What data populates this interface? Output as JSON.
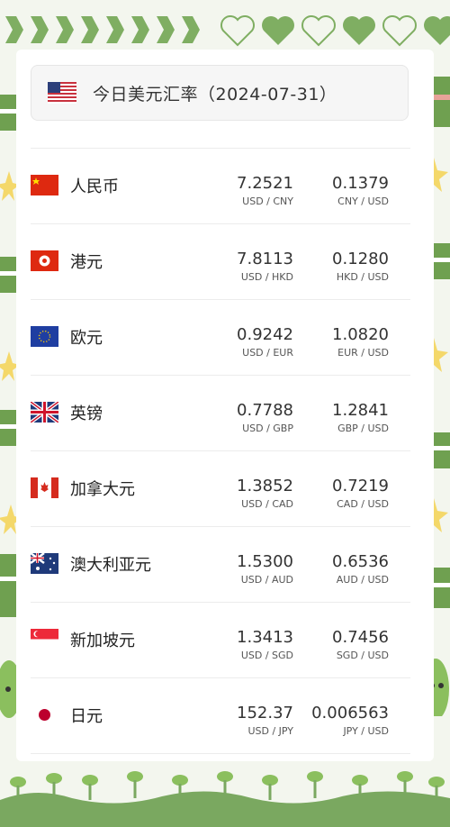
{
  "header": {
    "title": "今日美元汇率（2024-07-31）",
    "flag_icon": "us-flag-icon"
  },
  "rates": [
    {
      "name": "人民币",
      "flag": "cn-flag-icon",
      "rate": "7.2521",
      "rate_unit": "USD / CNY",
      "inverse": "0.1379",
      "inverse_unit": "CNY / USD"
    },
    {
      "name": "港元",
      "flag": "hk-flag-icon",
      "rate": "7.8113",
      "rate_unit": "USD / HKD",
      "inverse": "0.1280",
      "inverse_unit": "HKD / USD"
    },
    {
      "name": "欧元",
      "flag": "eu-flag-icon",
      "rate": "0.9242",
      "rate_unit": "USD / EUR",
      "inverse": "1.0820",
      "inverse_unit": "EUR / USD"
    },
    {
      "name": "英镑",
      "flag": "gb-flag-icon",
      "rate": "0.7788",
      "rate_unit": "USD / GBP",
      "inverse": "1.2841",
      "inverse_unit": "GBP / USD"
    },
    {
      "name": "加拿大元",
      "flag": "ca-flag-icon",
      "rate": "1.3852",
      "rate_unit": "USD / CAD",
      "inverse": "0.7219",
      "inverse_unit": "CAD / USD"
    },
    {
      "name": "澳大利亚元",
      "flag": "au-flag-icon",
      "rate": "1.5300",
      "rate_unit": "USD / AUD",
      "inverse": "0.6536",
      "inverse_unit": "AUD / USD"
    },
    {
      "name": "新加坡元",
      "flag": "sg-flag-icon",
      "rate": "1.3413",
      "rate_unit": "USD / SGD",
      "inverse": "0.7456",
      "inverse_unit": "SGD / USD"
    },
    {
      "name": "日元",
      "flag": "jp-flag-icon",
      "rate": "152.37",
      "rate_unit": "USD / JPY",
      "inverse": "0.006563",
      "inverse_unit": "JPY / USD"
    }
  ],
  "colors": {
    "frame_green": "#7aa860",
    "background": "#f3f6ee"
  }
}
